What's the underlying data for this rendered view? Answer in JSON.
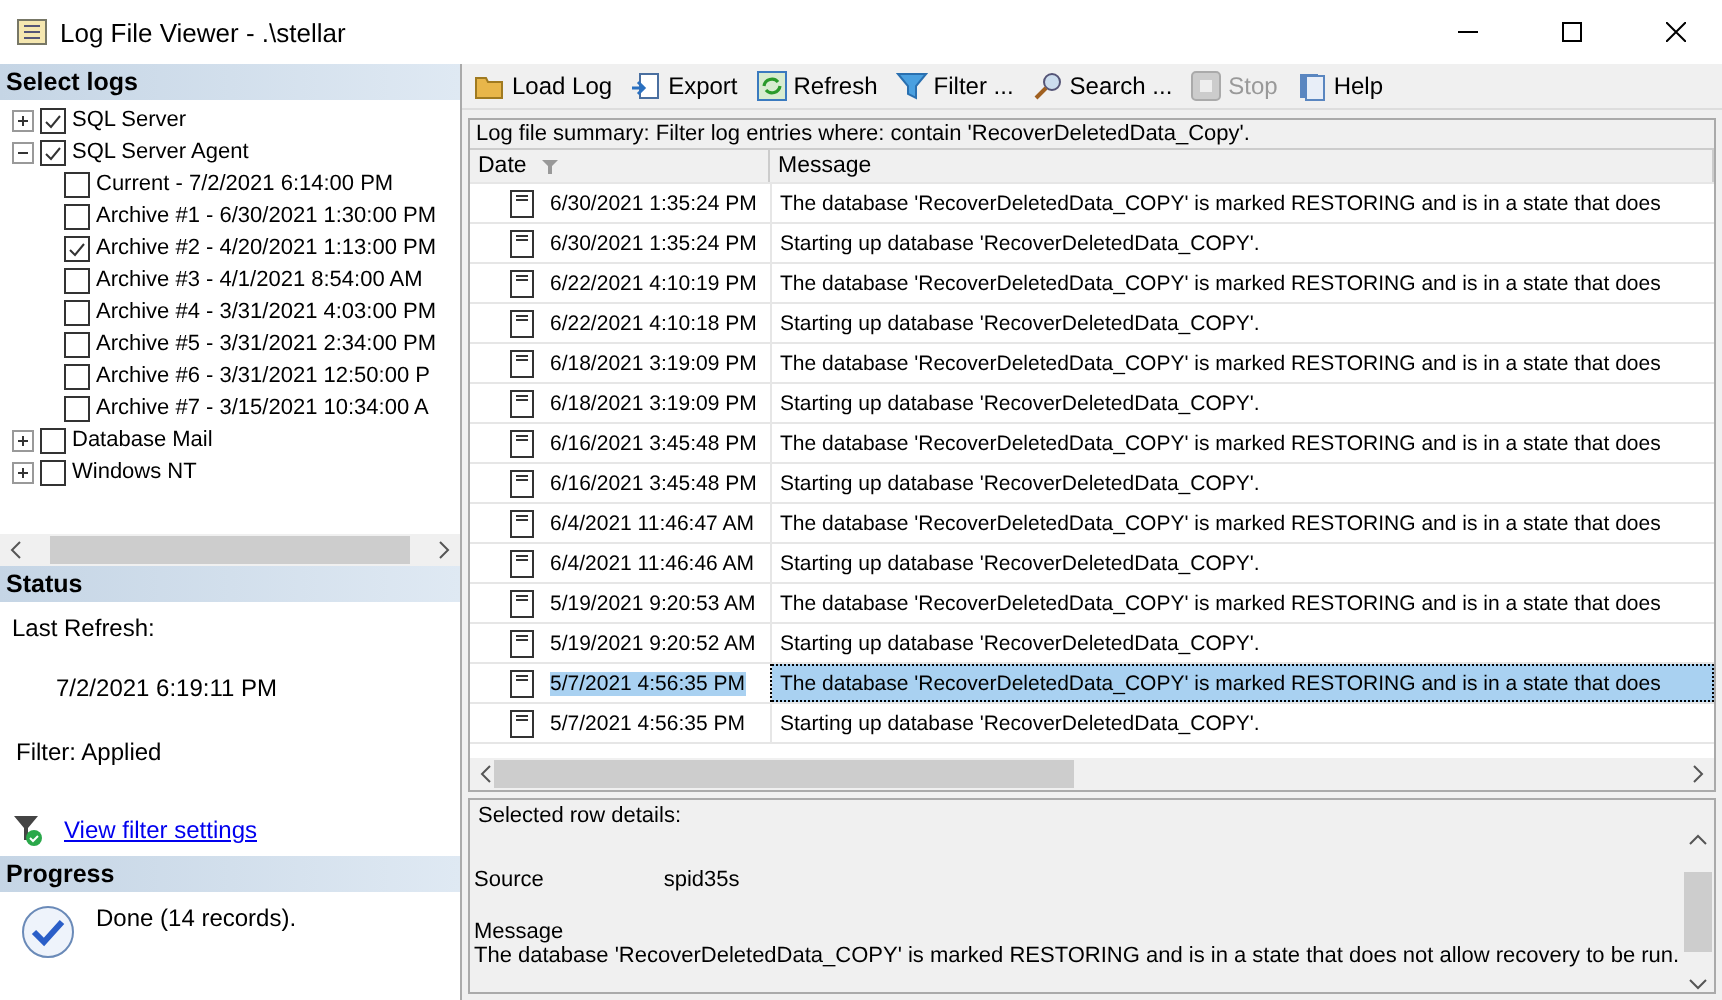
{
  "window": {
    "title": "Log File Viewer - .\\stellar"
  },
  "select_logs": {
    "header": "Select logs",
    "tree": [
      {
        "label": "SQL Server",
        "checked": true,
        "expanded": false
      },
      {
        "label": "SQL Server Agent",
        "checked": true,
        "expanded": true,
        "children": [
          {
            "label": "Current - 7/2/2021 6:14:00 PM",
            "checked": false
          },
          {
            "label": "Archive #1 - 6/30/2021 1:30:00 PM",
            "checked": false
          },
          {
            "label": "Archive #2 - 4/20/2021 1:13:00 PM",
            "checked": true
          },
          {
            "label": "Archive #3 - 4/1/2021 8:54:00 AM",
            "checked": false
          },
          {
            "label": "Archive #4 - 3/31/2021 4:03:00 PM",
            "checked": false
          },
          {
            "label": "Archive #5 - 3/31/2021 2:34:00 PM",
            "checked": false
          },
          {
            "label": "Archive #6 - 3/31/2021 12:50:00 P",
            "checked": false
          },
          {
            "label": "Archive #7 - 3/15/2021 10:34:00 A",
            "checked": false
          }
        ]
      },
      {
        "label": "Database Mail",
        "checked": false,
        "expanded": false
      },
      {
        "label": "Windows NT",
        "checked": false,
        "expanded": false
      }
    ]
  },
  "status": {
    "header": "Status",
    "last_refresh_label": "Last Refresh:",
    "last_refresh": "7/2/2021 6:19:11 PM",
    "filter": "Filter: Applied",
    "link": "View filter settings"
  },
  "progress": {
    "header": "Progress",
    "text": "Done (14 records)."
  },
  "toolbar": [
    {
      "kind": "folder",
      "label": "Load Log",
      "disabled": false
    },
    {
      "kind": "export",
      "label": "Export",
      "disabled": false
    },
    {
      "kind": "refresh",
      "label": "Refresh",
      "disabled": false
    },
    {
      "kind": "filter",
      "label": "Filter ...",
      "disabled": false
    },
    {
      "kind": "search",
      "label": "Search ...",
      "disabled": false
    },
    {
      "kind": "stop",
      "label": "Stop",
      "disabled": true
    },
    {
      "kind": "help",
      "label": "Help",
      "disabled": false
    }
  ],
  "summary": "Log file summary: Filter log entries where: contain 'RecoverDeletedData_Copy'.",
  "table": {
    "columns": [
      "Date",
      "Message"
    ],
    "rows": [
      {
        "date": "6/30/2021 1:35:24 PM",
        "message": "The database 'RecoverDeletedData_COPY' is marked RESTORING and is in a state that does",
        "selected": false
      },
      {
        "date": "6/30/2021 1:35:24 PM",
        "message": "Starting up database 'RecoverDeletedData_COPY'.",
        "selected": false
      },
      {
        "date": "6/22/2021 4:10:19 PM",
        "message": "The database 'RecoverDeletedData_COPY' is marked RESTORING and is in a state that does",
        "selected": false
      },
      {
        "date": "6/22/2021 4:10:18 PM",
        "message": "Starting up database 'RecoverDeletedData_COPY'.",
        "selected": false
      },
      {
        "date": "6/18/2021 3:19:09 PM",
        "message": "The database 'RecoverDeletedData_COPY' is marked RESTORING and is in a state that does",
        "selected": false
      },
      {
        "date": "6/18/2021 3:19:09 PM",
        "message": "Starting up database 'RecoverDeletedData_COPY'.",
        "selected": false
      },
      {
        "date": "6/16/2021 3:45:48 PM",
        "message": "The database 'RecoverDeletedData_COPY' is marked RESTORING and is in a state that does",
        "selected": false
      },
      {
        "date": "6/16/2021 3:45:48 PM",
        "message": "Starting up database 'RecoverDeletedData_COPY'.",
        "selected": false
      },
      {
        "date": "6/4/2021 11:46:47 AM",
        "message": "The database 'RecoverDeletedData_COPY' is marked RESTORING and is in a state that does",
        "selected": false
      },
      {
        "date": "6/4/2021 11:46:46 AM",
        "message": "Starting up database 'RecoverDeletedData_COPY'.",
        "selected": false
      },
      {
        "date": "5/19/2021 9:20:53 AM",
        "message": "The database 'RecoverDeletedData_COPY' is marked RESTORING and is in a state that does",
        "selected": false
      },
      {
        "date": "5/19/2021 9:20:52 AM",
        "message": "Starting up database 'RecoverDeletedData_COPY'.",
        "selected": false
      },
      {
        "date": "5/7/2021 4:56:35 PM",
        "message": "The database 'RecoverDeletedData_COPY' is marked RESTORING and is in a state that does",
        "selected": true
      },
      {
        "date": "5/7/2021 4:56:35 PM",
        "message": "Starting up database 'RecoverDeletedData_COPY'.",
        "selected": false
      }
    ]
  },
  "details": {
    "header": "Selected row details:",
    "source_label": "Source",
    "source": "spid35s",
    "message_label": "Message",
    "message": "The database 'RecoverDeletedData_COPY' is marked RESTORING and is in a state that does not allow recovery to be run."
  }
}
